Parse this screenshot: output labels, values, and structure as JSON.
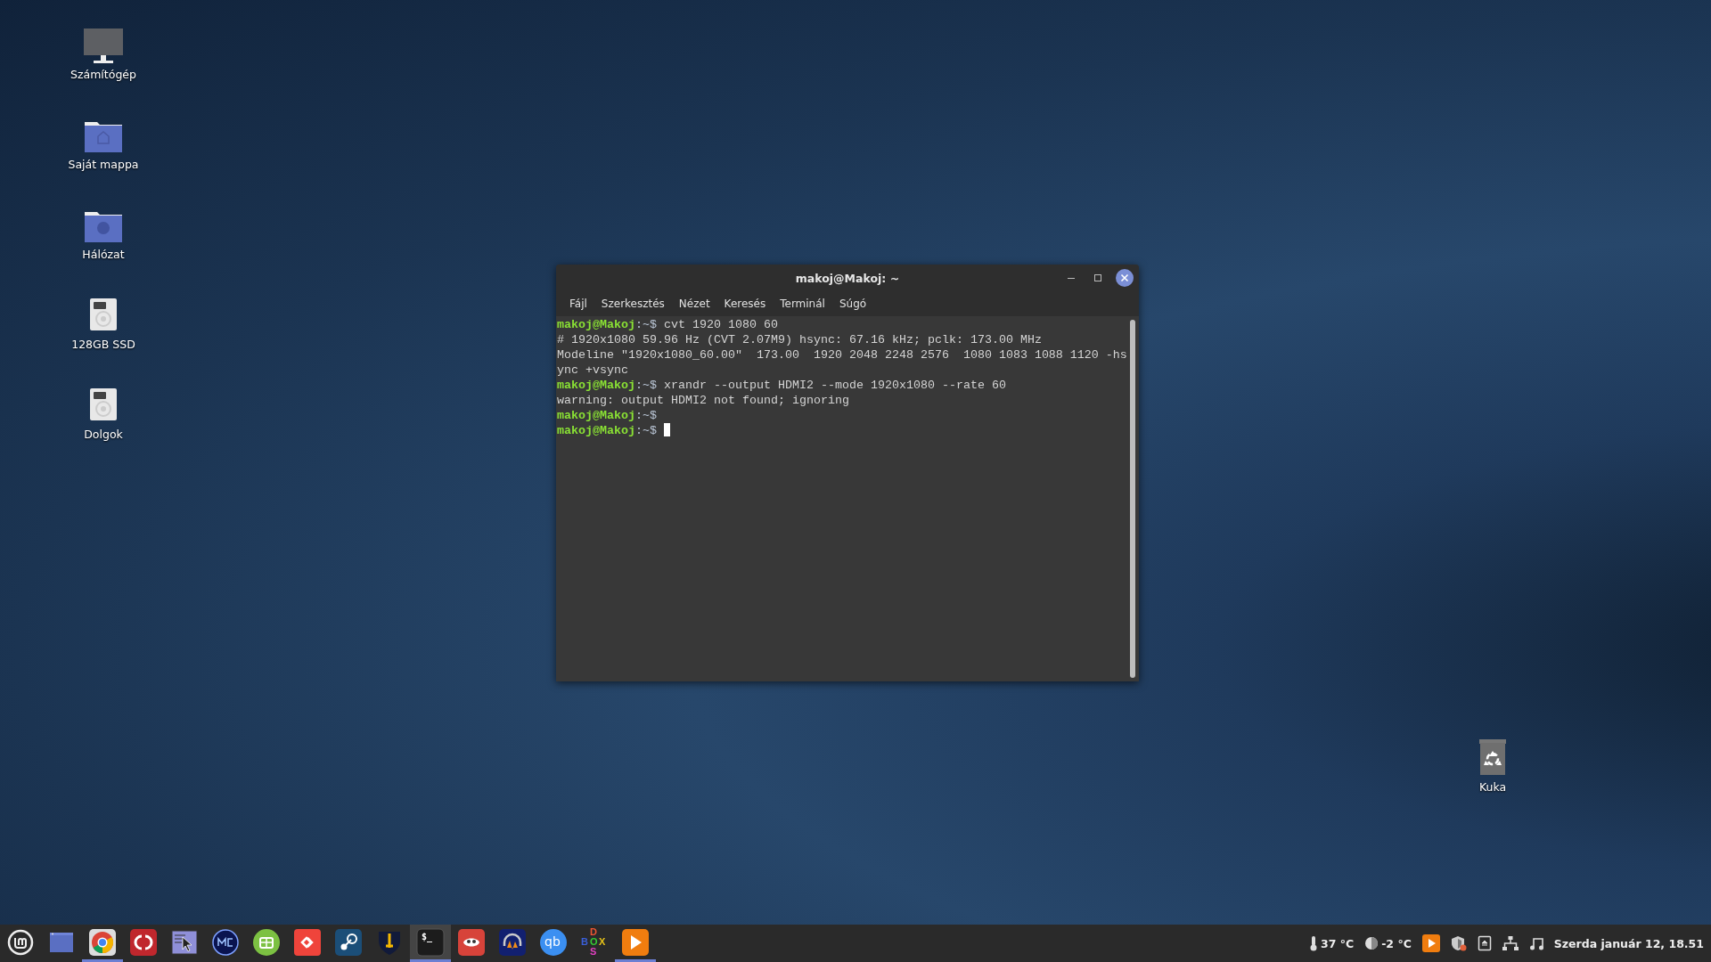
{
  "desktop_icons": [
    {
      "kind": "computer",
      "label": "Számítógép"
    },
    {
      "kind": "home-folder",
      "label": "Saját mappa"
    },
    {
      "kind": "network-folder",
      "label": "Hálózat"
    },
    {
      "kind": "drive",
      "label": "128GB SSD"
    },
    {
      "kind": "drive",
      "label": "Dolgok"
    }
  ],
  "trash_icon": {
    "kind": "trash",
    "label": "Kuka"
  },
  "terminal": {
    "title": "makoj@Makoj: ~",
    "menu": [
      "Fájl",
      "Szerkesztés",
      "Nézet",
      "Keresés",
      "Terminál",
      "Súgó"
    ],
    "lines": [
      {
        "kind": "prompt",
        "user": "makoj@Makoj",
        "path": ":~$ ",
        "command": "cvt 1920 1080 60"
      },
      {
        "kind": "output",
        "text": "# 1920x1080 59.96 Hz (CVT 2.07M9) hsync: 67.16 kHz; pclk: 173.00 MHz"
      },
      {
        "kind": "output",
        "text": "Modeline \"1920x1080_60.00\"  173.00  1920 2048 2248 2576  1080 1083 1088 1120 -hsync +vsync"
      },
      {
        "kind": "prompt",
        "user": "makoj@Makoj",
        "path": ":~$ ",
        "command": "xrandr --output HDMI2 --mode 1920x1080 --rate 60"
      },
      {
        "kind": "output",
        "text": "warning: output HDMI2 not found; ignoring"
      },
      {
        "kind": "prompt",
        "user": "makoj@Makoj",
        "path": ":~$"
      },
      {
        "kind": "prompt",
        "user": "makoj@Makoj",
        "path": ":~$ ",
        "cursor": true
      }
    ]
  },
  "taskbar": {
    "apps": [
      {
        "kind": "files",
        "running": false,
        "active": false
      },
      {
        "kind": "chrome",
        "running": true,
        "active": false
      },
      {
        "kind": "dual-pane",
        "running": false,
        "active": false
      },
      {
        "kind": "pointer",
        "running": false,
        "active": false
      },
      {
        "kind": "mc",
        "running": false,
        "active": false
      },
      {
        "kind": "green-box",
        "running": false,
        "active": false
      },
      {
        "kind": "remote",
        "running": false,
        "active": false
      },
      {
        "kind": "steam",
        "running": false,
        "active": false
      },
      {
        "kind": "sword",
        "running": false,
        "active": false
      },
      {
        "kind": "terminal",
        "glyph": "$_",
        "running": true,
        "active": true
      },
      {
        "kind": "gimp",
        "running": false,
        "active": false
      },
      {
        "kind": "audacity",
        "running": false,
        "active": false
      },
      {
        "kind": "qbit",
        "glyph": "qb",
        "running": false,
        "active": false
      },
      {
        "kind": "dosbox",
        "letters": [
          "D",
          "B",
          "O",
          "X",
          "S"
        ],
        "running": false,
        "active": false
      },
      {
        "kind": "vlc",
        "running": true,
        "active": false
      }
    ],
    "tray": [
      {
        "kind": "thermometer",
        "text": "37 °C"
      },
      {
        "kind": "moon",
        "text": "-2 °C"
      },
      {
        "kind": "vlc"
      },
      {
        "kind": "shield"
      },
      {
        "kind": "eject"
      },
      {
        "kind": "network"
      },
      {
        "kind": "music"
      }
    ],
    "clock": "Szerda január 12, 18.51"
  }
}
